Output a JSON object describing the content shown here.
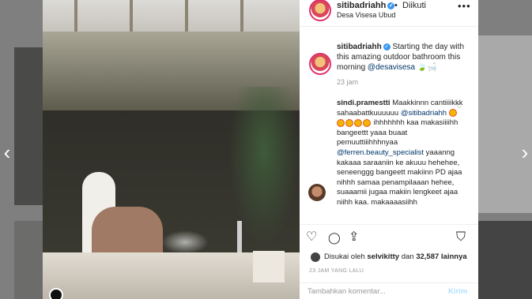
{
  "post": {
    "username": "sitibadriahh",
    "follow_label": "Diikuti",
    "dot": "•",
    "location": "Desa Visesa Ubud",
    "more_icon": "•••",
    "caption": {
      "username": "sitibadriahh",
      "text": "Starting the day with this amazing outdoor bathroom this morning",
      "mention": "@desavisesa",
      "emoji": "🍃🛁",
      "time": "23 jam"
    },
    "comment": {
      "username": "sindi.pramestti",
      "text1": "Maakkinnn cantiiiikkk sahaabattkuuuuuu",
      "mention1": "@sitibadriahh",
      "text2": "ihhhhhhh kaa makasiiiihh bangeettt yaaa buaat pemuuttiiihhhnyaa",
      "mention2": "@ferren.beauty_specialist",
      "text3": "yaaanng kakaaa saraaniin ke akuuu hehehee, seneenggg bangeett makiinn PD ajaa nihhh samaa penampilaaan hehee, suaaamii jugaa makiin lengkeet ajaa niihh kaa. makaaaasiihh"
    },
    "likes": {
      "prefix": "Disukai oleh",
      "user": "selvikitty",
      "conj": "dan",
      "count": "32,587",
      "suffix": "lainnya"
    },
    "timestamp": "23 JAM YANG LALU",
    "comment_placeholder": "Tambahkan komentar...",
    "send_label": "Kirim"
  },
  "icons": {
    "nav_left": "‹",
    "nav_right": "›",
    "heart": "♡",
    "like": "♡",
    "comment": "◯",
    "share": "⇪",
    "save": "⛉",
    "verified": "✓"
  }
}
